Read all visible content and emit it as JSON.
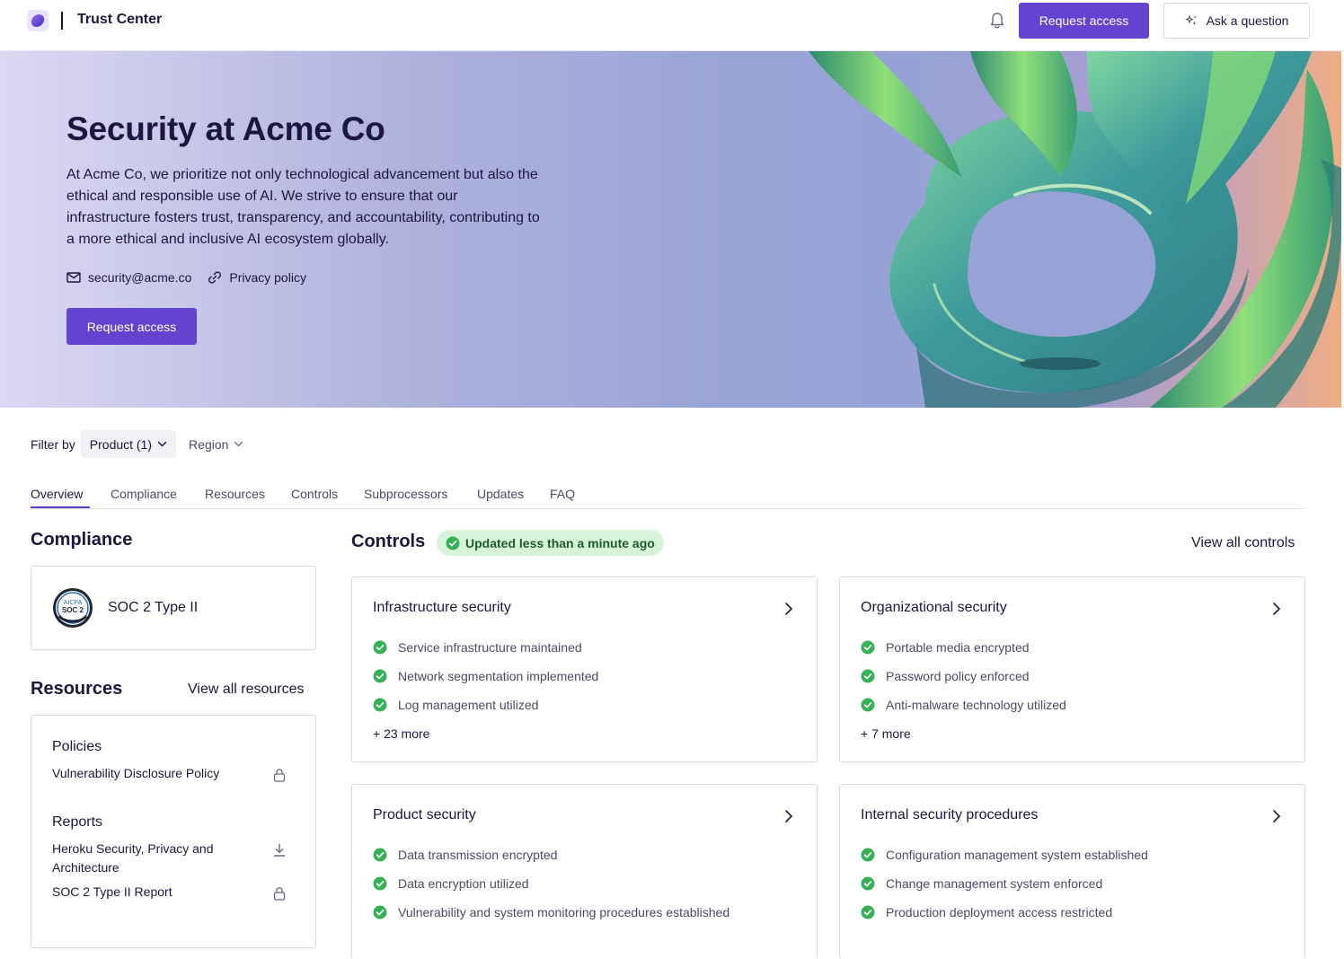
{
  "header": {
    "brand": "Trust Center",
    "request_label": "Request access",
    "ask_label": "Ask a question"
  },
  "icons": {
    "logo": "logo-icon",
    "bell": "bell-icon",
    "sparkle": "sparkle-icon",
    "mail": "mail-icon",
    "link": "link-icon",
    "chevron": "chevron-right-icon",
    "check": "check-circle-icon",
    "lock": "lock-icon",
    "download": "download-icon"
  },
  "colors": {
    "accent": "#6343cf",
    "success": "#35b155",
    "success_bg": "#d7f4d9",
    "text": "#1d1640"
  },
  "hero": {
    "title": "Security at Acme Co",
    "description": "At Acme Co, we prioritize not only technological advancement but also the ethical and responsible use of AI. We strive to ensure that our infrastructure fosters trust, transparency, and accountability, contributing to a more ethical and inclusive AI ecosystem globally.",
    "email": "security@acme.co",
    "privacy": "Privacy policy",
    "request_label": "Request access"
  },
  "filter": {
    "label": "Filter by",
    "product": "Product (1)",
    "region": "Region"
  },
  "tabs": [
    "Overview",
    "Compliance",
    "Resources",
    "Controls",
    "Subprocessors",
    "Updates",
    "FAQ"
  ],
  "compliance": {
    "heading": "Compliance",
    "badge_top": "AICPA",
    "badge_main": "SOC 2",
    "item": "SOC 2 Type II"
  },
  "resources": {
    "heading": "Resources",
    "view_all": "View all resources",
    "policies_heading": "Policies",
    "policies": [
      "Vulnerability Disclosure Policy"
    ],
    "reports_heading": "Reports",
    "reports": [
      "Heroku Security, Privacy and Architecture",
      "SOC 2 Type II Report"
    ]
  },
  "controls": {
    "heading": "Controls",
    "updated": "Updated less than a minute ago",
    "view_all": "View all controls",
    "cards": [
      {
        "title": "Infrastructure security",
        "items": [
          "Service infrastructure maintained",
          "Network segmentation implemented",
          "Log management utilized"
        ],
        "more": "+ 23 more"
      },
      {
        "title": "Organizational security",
        "items": [
          "Portable media encrypted",
          "Password policy enforced",
          "Anti-malware technology utilized"
        ],
        "more": "+ 7 more"
      },
      {
        "title": "Product security",
        "items": [
          "Data transmission encrypted",
          "Data encryption utilized",
          "Vulnerability and system monitoring procedures established"
        ]
      },
      {
        "title": "Internal security procedures",
        "items": [
          "Configuration management system established",
          "Change management system enforced",
          "Production deployment access restricted"
        ]
      }
    ]
  }
}
